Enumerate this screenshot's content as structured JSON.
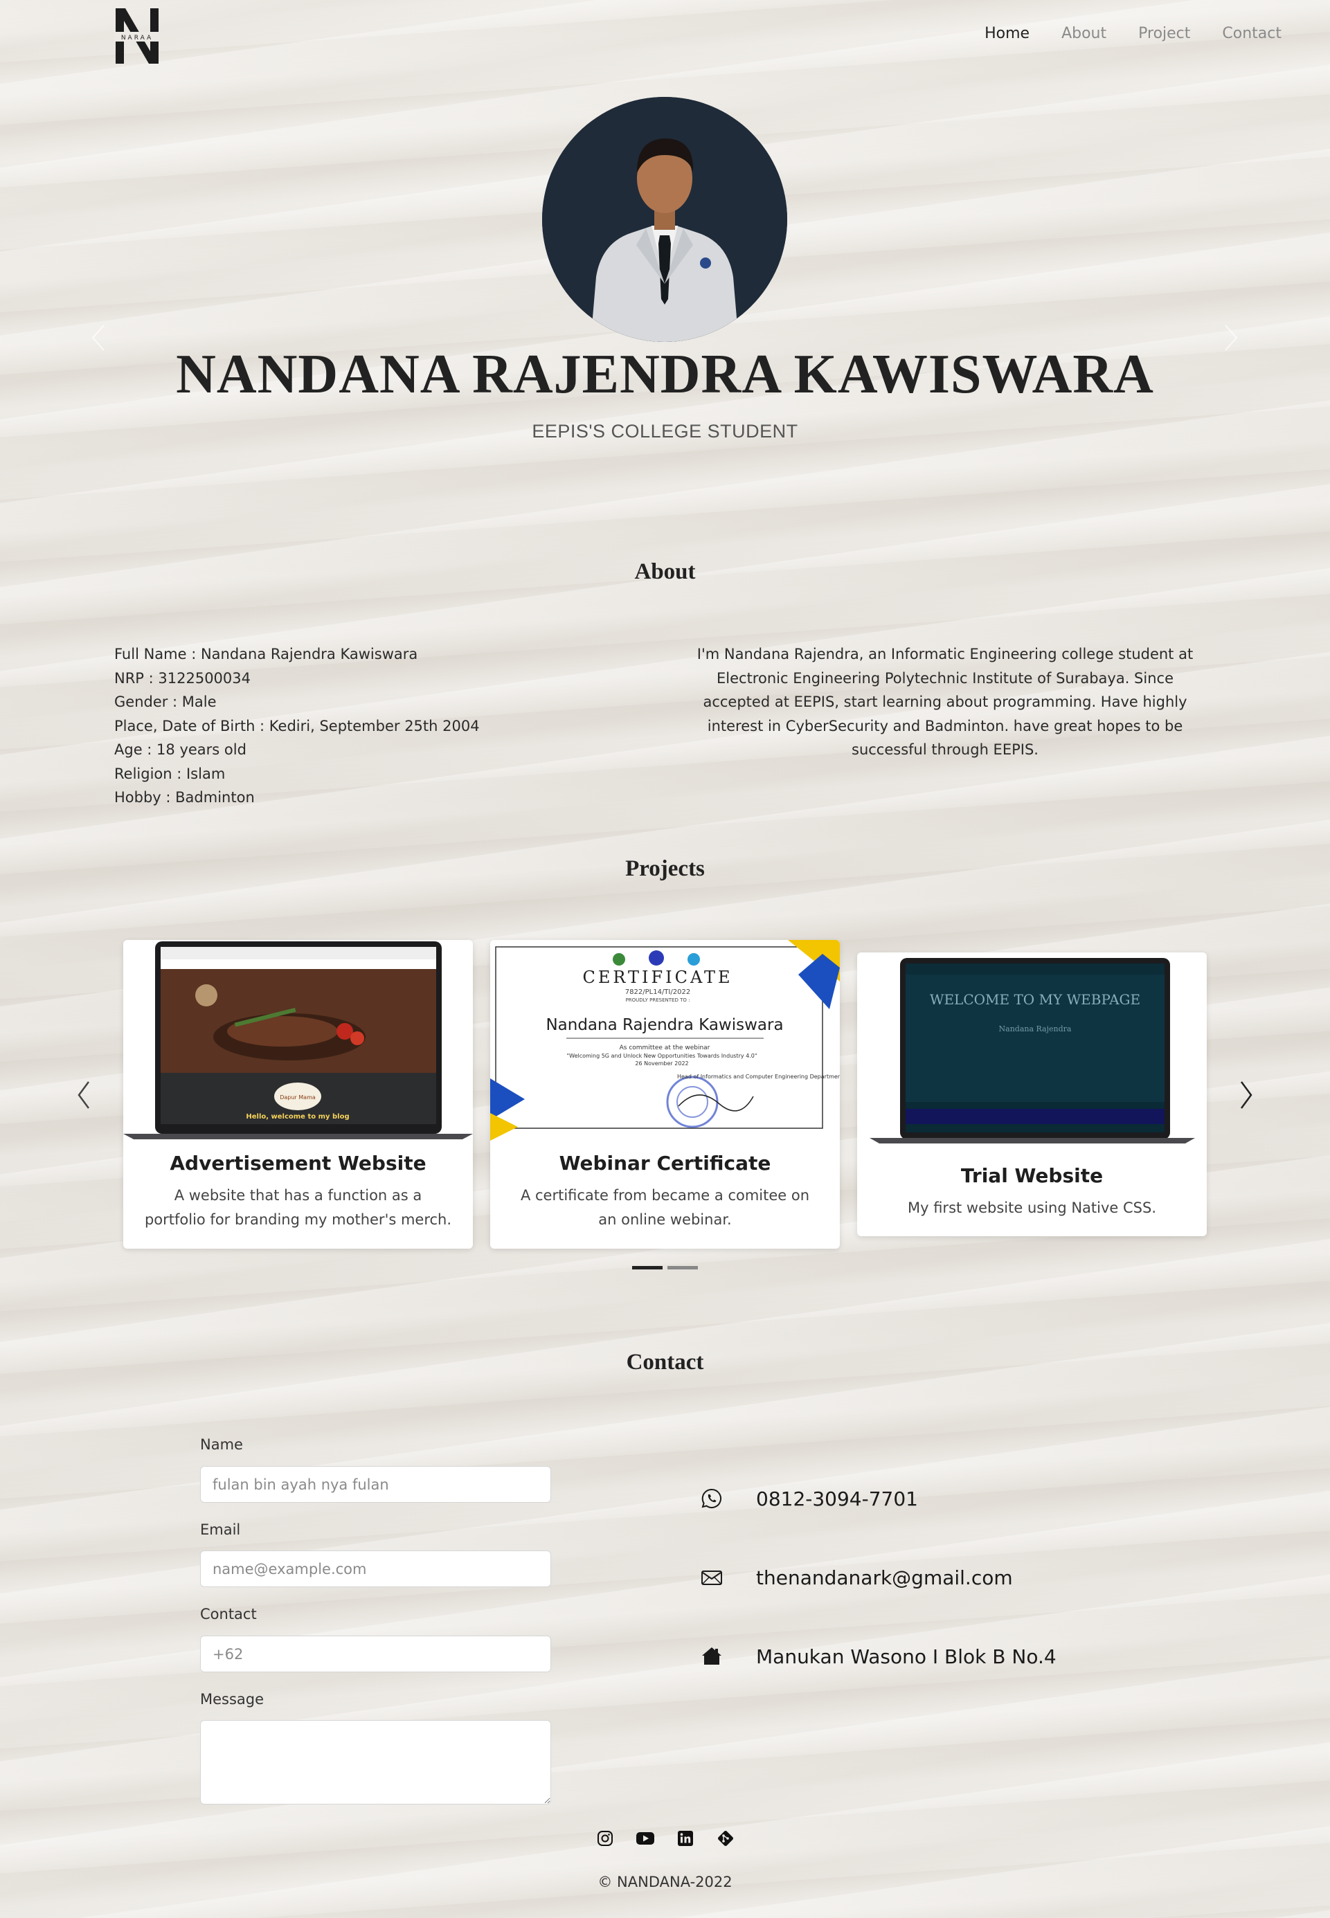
{
  "nav": {
    "logo_text": "NARAA",
    "items": [
      {
        "label": "Home",
        "active": true
      },
      {
        "label": "About",
        "active": false
      },
      {
        "label": "Project",
        "active": false
      },
      {
        "label": "Contact",
        "active": false
      }
    ]
  },
  "hero": {
    "name": "NANDANA RAJENDRA KAWISWARA",
    "subtitle": "EEPIS'S COLLEGE STUDENT"
  },
  "about": {
    "title": "About",
    "facts": [
      "Full Name : Nandana Rajendra Kawiswara",
      "NRP : 3122500034",
      "Gender : Male",
      "Place, Date of Birth : Kediri, September 25th 2004",
      "Age : 18 years old",
      "Religion : Islam",
      "Hobby : Badminton"
    ],
    "description": "I'm Nandana Rajendra, an Informatic Engineering college student at Electronic Engineering Polytechnic Institute of Surabaya. Since accepted at EEPIS, start learning about programming. Have highly interest in CyberSecurity and Badminton. have great hopes to be successful through EEPIS."
  },
  "projects": {
    "title": "Projects",
    "cards": [
      {
        "title": "Advertisement Website",
        "desc": "A website that has a function as a portfolio for branding my mother's merch."
      },
      {
        "title": "Webinar Certificate",
        "desc": "A certificate from became a comitee on an online webinar."
      },
      {
        "title": "Trial Website",
        "desc": "My first website using Native CSS."
      }
    ],
    "screens": {
      "ad": {
        "headline": "Hello, welcome to my blog"
      },
      "cert": {
        "heading": "CERTIFICATE",
        "number": "7822/PL14/TI/2022",
        "presented": "PROUDLY PRESENTED TO :",
        "name": "Nandana Rajendra Kawiswara",
        "line1": "As committee at the webinar",
        "line2": "\"Welcoming 5G and Unlock New Opportunities Towards Industry 4.0\"",
        "line3": "26 November 2022",
        "line4": "Head of Informatics and Computer Engineering Department"
      },
      "trial": {
        "headline": "WELCOME TO MY WEBPAGE",
        "sub": "Nandana Rajendra"
      }
    },
    "active_slide": 1,
    "total_slides": 2
  },
  "contact": {
    "title": "Contact",
    "form": {
      "name_label": "Name",
      "name_placeholder": "fulan bin ayah nya fulan",
      "email_label": "Email",
      "email_placeholder": "name@example.com",
      "contact_label": "Contact",
      "contact_placeholder": "+62",
      "message_label": "Message",
      "message_placeholder": ""
    },
    "info": {
      "phone": "0812-3094-7701",
      "email": "thenandanark@gmail.com",
      "address": "Manukan Wasono I Blok B No.4"
    }
  },
  "footer": {
    "socials": [
      "instagram-icon",
      "youtube-icon",
      "linkedin-icon",
      "git-icon"
    ],
    "copyright": "© NANDANA-2022"
  },
  "colors": {
    "avatar_bg": "#1f2b39",
    "card_bg": "#ffffff",
    "text": "#212529",
    "nav_inactive": "#8a8a8a"
  }
}
